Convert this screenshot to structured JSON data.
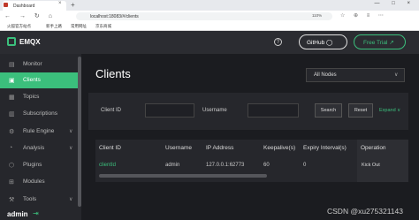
{
  "browser": {
    "tab_title": "Dashboard",
    "tab_close": "×",
    "new_tab": "+",
    "window_controls": "— □ ×",
    "nav_icons": "← → ↻ ⌂",
    "url": "localhost:18083/#/clients",
    "zoom": "110%",
    "toolbar_icons": "☆ ⊕ ≡ ⋯",
    "bookmarks": [
      "火狐官方站点",
      "新手上路",
      "常用网址",
      "京东商城"
    ]
  },
  "header": {
    "logo": "EMQX",
    "help_icon": "?",
    "github_label": "GitHub ◯",
    "trial_label": "Free Trial ↗"
  },
  "sidebar": {
    "items": [
      {
        "label": "Monitor",
        "icon": "▤"
      },
      {
        "label": "Clients",
        "icon": "▣"
      },
      {
        "label": "Topics",
        "icon": "▦"
      },
      {
        "label": "Subscriptions",
        "icon": "▥"
      },
      {
        "label": "Rule Engine",
        "icon": "⚙"
      },
      {
        "label": "Analysis",
        "icon": "◔"
      },
      {
        "label": "Plugins",
        "icon": "⬡"
      },
      {
        "label": "Modules",
        "icon": "⊞"
      },
      {
        "label": "Tools",
        "icon": "⚒"
      }
    ],
    "chevron": "∨",
    "user": "admin",
    "logout_icon": "⇥"
  },
  "main": {
    "title": "Clients",
    "node_select": "All Nodes",
    "node_select_chev": "∨",
    "filter": {
      "clientid_label": "Client ID",
      "username_label": "Username",
      "search_label": "Search",
      "reset_label": "Reset",
      "expand_label": "Expand ∨"
    },
    "table": {
      "headers": [
        "Client ID",
        "Username",
        "IP Address",
        "Keepalive(s)",
        "Expiry Interval(s)",
        "Operation"
      ],
      "rows": [
        {
          "client_id": "clientId",
          "username": "admin",
          "ip": "127.0.0.1:62773",
          "keepalive": "60",
          "expiry": "0",
          "operation": "Kick Out"
        }
      ]
    }
  },
  "watermark": "CSDN @xu275321143",
  "colors": {
    "accent": "#3bbf7c",
    "background": "#1b1c20",
    "panel": "#26272c"
  }
}
